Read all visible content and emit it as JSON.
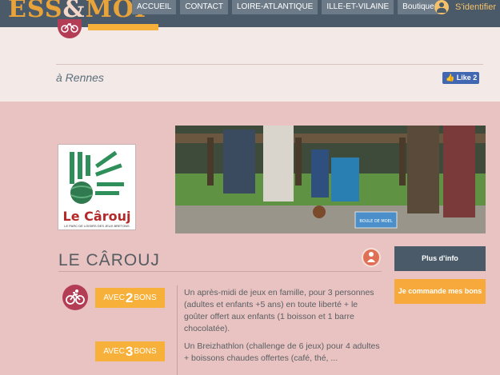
{
  "header": {
    "logo_left": "ESS",
    "logo_amp": "&",
    "logo_right": "MOI",
    "nav": [
      "ACCUEIL",
      "CONTACT",
      "LOIRE-ATLANTIQUE",
      "ILLE-ET-VILAINE",
      "Boutique"
    ],
    "login_label": "S'identifier"
  },
  "upper": {
    "city": "à Rennes",
    "fb_like_label": "Like 2"
  },
  "card": {
    "logo_brand": "Le Cârouj",
    "logo_tagline": "LE PARC DE LOISIRS DES JEUX BRETONS",
    "photo_sign": "BOULE DE MOEL",
    "title": "LE CÂROUJ",
    "info_button": "Plus d'info",
    "order_button": "Je commande mes bons",
    "offers": [
      {
        "prefix": "AVEC",
        "number": "2",
        "suffix": "BONS",
        "text": "Un après-midi de jeux en famille, pour 3 personnes (adultes et enfants +5 ans) en toute liberté + le goûter offert aux enfants (1 boisson et 1 barre chocolatée)."
      },
      {
        "prefix": "AVEC",
        "number": "3",
        "suffix": "BONS",
        "text": "Un Breizhathlon (challenge de 6 jeux) pour 4 adultes + boissons chaudes offertes (café, thé, ..."
      }
    ]
  },
  "colors": {
    "header_bg": "#4b5a69",
    "accent_orange": "#f7b13a",
    "accent_red": "#b43d56",
    "card_bg": "#e8c3c1"
  }
}
